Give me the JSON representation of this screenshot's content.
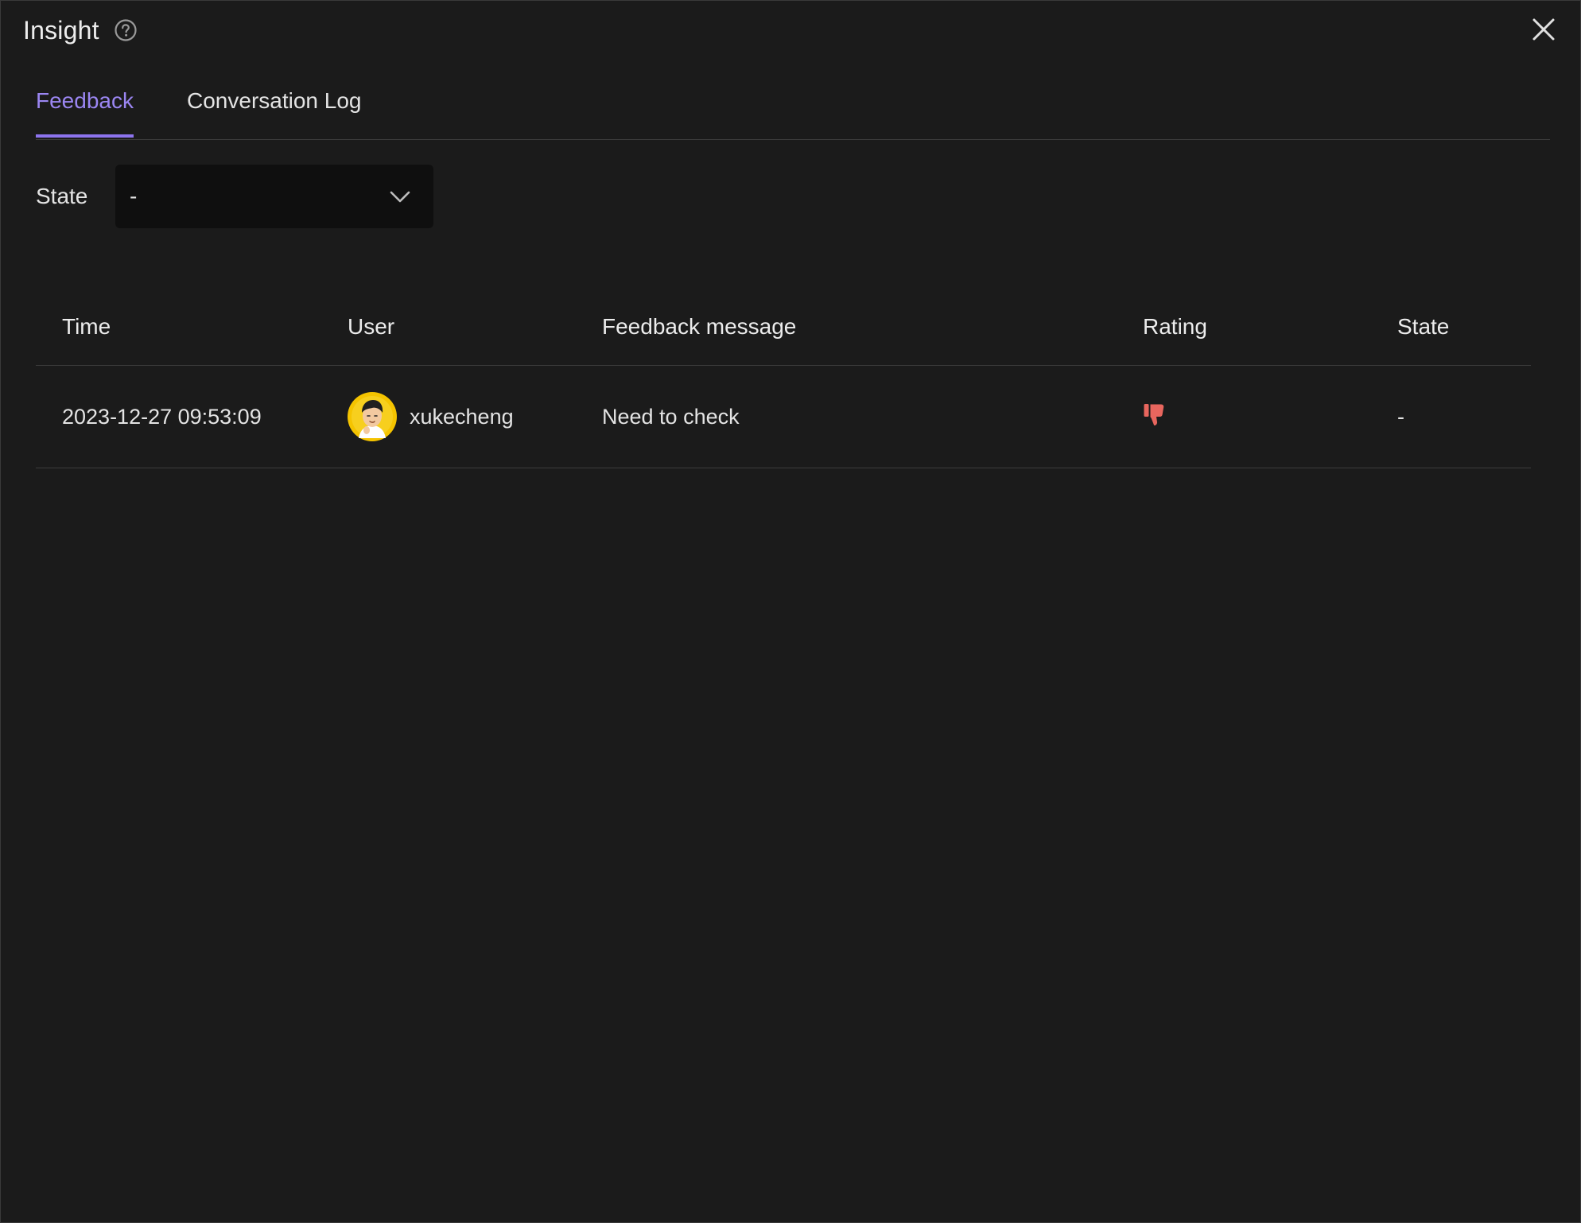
{
  "window": {
    "title": "Insight"
  },
  "tabs": [
    {
      "label": "Feedback",
      "active": true
    },
    {
      "label": "Conversation Log",
      "active": false
    }
  ],
  "filter": {
    "label": "State",
    "selected_value": "-"
  },
  "table": {
    "columns": [
      "Time",
      "User",
      "Feedback message",
      "Rating",
      "State"
    ],
    "rows": [
      {
        "time": "2023-12-27 09:53:09",
        "user": "xukecheng",
        "message": "Need to check",
        "rating": "thumbs-down",
        "state": "-"
      }
    ]
  },
  "colors": {
    "accent": "#8d74ee",
    "rating_negative": "#e8665e",
    "background": "#1b1b1b",
    "select_background": "#0f0f0f"
  }
}
